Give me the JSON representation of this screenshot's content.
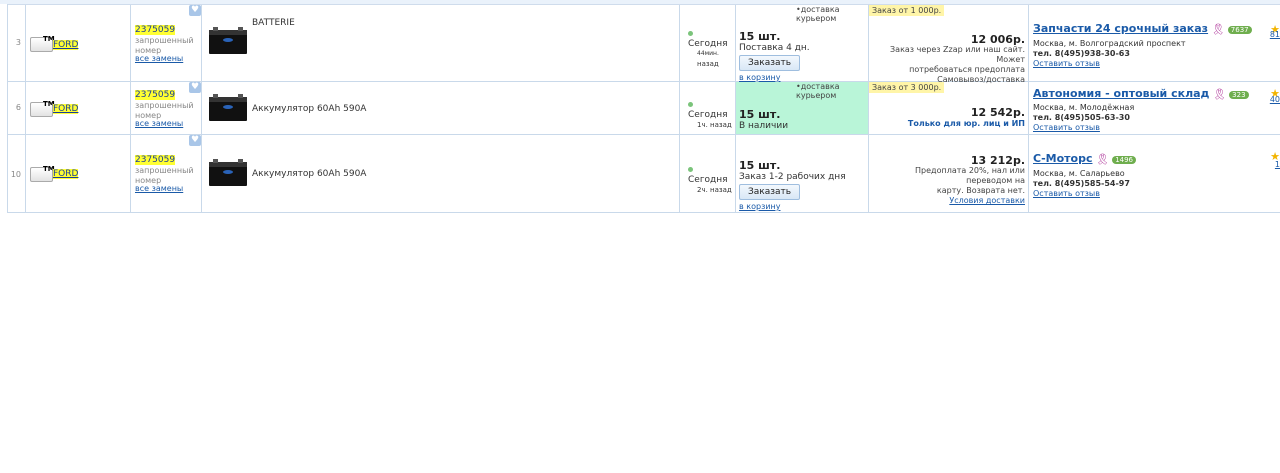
{
  "rows": [
    {
      "num": "3",
      "brand": "FORD",
      "tm": "TM",
      "article": "2375059",
      "requested_label_1": "запрошенный",
      "requested_label_2": "номер",
      "replacements_link": "все замены",
      "product_name": "BATTERIE",
      "updated_1": "Сегодня",
      "updated_2": "44мин.",
      "updated_3": "назад",
      "qty": "15 шт.",
      "availability": "Поставка 4 дн.",
      "order_button": "Заказать",
      "to_cart": "в корзину",
      "delivery": "•доставка курьером",
      "order_from": "Заказ от 1 000р.",
      "price": "12 006р.",
      "note_1": "Заказ через Zzap или наш сайт. Может",
      "note_2": "потребоваться предоплата",
      "note_3": "Самовывоз/доставка",
      "seller_name": "Запчасти 24 срочный заказ",
      "seller_badge": "7637",
      "seller_address": "Москва, м. Волгоградский проспект",
      "seller_phone": "тел. 8(495)938-30-63",
      "review_link": "Оставить отзыв",
      "side_num": "81"
    },
    {
      "num": "6",
      "brand": "FORD",
      "tm": "TM",
      "article": "2375059",
      "requested_label_1": "запрошенный",
      "requested_label_2": "номер",
      "replacements_link": "все замены",
      "product_name": "Аккумулятор 60Ah 590A",
      "updated_1": "Сегодня",
      "updated_2": "1ч. назад",
      "qty": "15 шт.",
      "availability": "В наличии",
      "delivery": "•доставка курьером",
      "order_from": "Заказ от 3 000р.",
      "price": "12 542р.",
      "note_1": "Только для юр. лиц и ИП",
      "seller_name": "Автономия - оптовый склад",
      "seller_badge": "323",
      "seller_address": "Москва, м. Молодёжная",
      "seller_phone": "тел. 8(495)505-63-30",
      "review_link": "Оставить отзыв",
      "side_num": "40"
    },
    {
      "num": "10",
      "brand": "FORD",
      "tm": "TM",
      "article": "2375059",
      "requested_label_1": "запрошенный",
      "requested_label_2": "номер",
      "replacements_link": "все замены",
      "product_name": "Аккумулятор 60Ah 590A",
      "updated_1": "Сегодня",
      "updated_2": "2ч. назад",
      "qty": "15 шт.",
      "availability": "Заказ 1-2 рабочих дня",
      "order_button": "Заказать",
      "to_cart": "в корзину",
      "price": "13 212р.",
      "note_1": "Предоплата 20%, нал или переводом на",
      "note_2": "карту. Возврата нет.",
      "note_3": "Условия доставки",
      "seller_name": "С-Моторс",
      "seller_badge": "1496",
      "seller_address": "Москва, м. Саларьево",
      "seller_phone": "тел. 8(495)585-54-97",
      "review_link": "Оставить отзыв",
      "side_num": "1"
    }
  ],
  "colors": {
    "highlight_yellow": "#ffff33",
    "link_blue": "#1a5aa8",
    "in_stock_green": "#b9f5d8",
    "border": "#c9d9ea"
  }
}
